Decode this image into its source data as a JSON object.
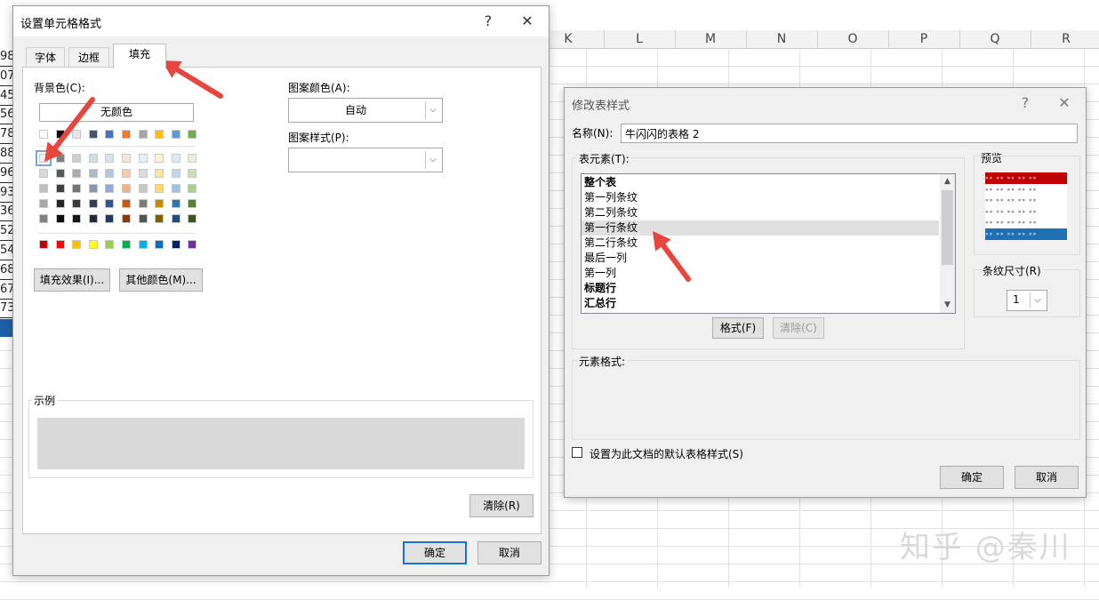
{
  "spreadsheet": {
    "columns": [
      "K",
      "L",
      "M",
      "N",
      "O",
      "P",
      "Q",
      "R"
    ],
    "row_cells": [
      "98",
      "07",
      "45",
      "56",
      "78",
      "88",
      "96",
      "93",
      "36",
      "52",
      "54",
      "68",
      "67",
      "73",
      ""
    ]
  },
  "format_cells": {
    "title": "设置单元格格式",
    "help": "?",
    "close": "✕",
    "tabs": [
      "字体",
      "边框",
      "填充"
    ],
    "active_tab": "填充",
    "background_color_label": "背景色(C):",
    "no_color": "无颜色",
    "pattern_color_label": "图案颜色(A):",
    "pattern_color_value": "自动",
    "pattern_style_label": "图案样式(P):",
    "pattern_style_value": "",
    "fill_effects_button": "填充效果(I)...",
    "more_colors_button": "其他颜色(M)...",
    "sample_label": "示例",
    "sample_color": "#d9d9d9",
    "clear_button": "清除(R)",
    "ok_button": "确定",
    "cancel_button": "取消",
    "theme_row": [
      "#ffffff",
      "#000000",
      "#e7e6e6",
      "#44546a",
      "#4472c4",
      "#ed7d31",
      "#a5a5a5",
      "#ffc000",
      "#5b9bd5",
      "#70ad47"
    ],
    "tint_rows": [
      [
        "#f2f2f2",
        "#7f7f7f",
        "#d0cece",
        "#d6dce4",
        "#d9e2f3",
        "#fbe5d5",
        "#ededed",
        "#fff2cc",
        "#ddebf7",
        "#e2efda"
      ],
      [
        "#d9d9d9",
        "#595959",
        "#aeaaaa",
        "#adb9ca",
        "#b4c6e7",
        "#f8cbad",
        "#dbdbdb",
        "#ffe599",
        "#bdd7ee",
        "#c6e0b4"
      ],
      [
        "#bfbfbf",
        "#404040",
        "#757171",
        "#8496b0",
        "#8eaadb",
        "#f4b183",
        "#c9c9c9",
        "#ffd966",
        "#9dc3e6",
        "#a9d08e"
      ],
      [
        "#a6a6a6",
        "#262626",
        "#3a3838",
        "#333f4f",
        "#2f5597",
        "#c55a11",
        "#7b7b7b",
        "#bf8f00",
        "#2e75b6",
        "#548235"
      ],
      [
        "#808080",
        "#0d0d0d",
        "#171616",
        "#222a35",
        "#1f3864",
        "#843c0b",
        "#525252",
        "#7f6000",
        "#1f4e79",
        "#375623"
      ]
    ],
    "standard_row": [
      "#c00000",
      "#ff0000",
      "#ffc000",
      "#ffff00",
      "#92d050",
      "#00b050",
      "#00b0f0",
      "#0070c0",
      "#002060",
      "#7030a0"
    ]
  },
  "modify_table_style": {
    "title": "修改表样式",
    "help": "?",
    "close": "✕",
    "name_label": "名称(N):",
    "name_value": "牛闪闪的表格 2",
    "table_element_label": "表元素(T):",
    "elements": [
      {
        "label": "整个表",
        "bold": true
      },
      {
        "label": "第一列条纹",
        "bold": false
      },
      {
        "label": "第二列条纹",
        "bold": false
      },
      {
        "label": "第一行条纹",
        "bold": false
      },
      {
        "label": "第二行条纹",
        "bold": false
      },
      {
        "label": "最后一列",
        "bold": false
      },
      {
        "label": "第一列",
        "bold": false
      },
      {
        "label": "标题行",
        "bold": true
      },
      {
        "label": "汇总行",
        "bold": true
      }
    ],
    "highlighted_element": "第一行条纹",
    "format_button": "格式(F)",
    "clear_button": "清除(C)",
    "preview_label": "预览",
    "preview_header_color": "#c00000",
    "preview_total_color": "#1f6fb5",
    "stripe_size_label": "条纹尺寸(R)",
    "stripe_size_value": "1",
    "element_format_label": "元素格式:",
    "default_checkbox_label": "设置为此文档的默认表格样式(S)",
    "ok_button": "确定",
    "cancel_button": "取消"
  },
  "watermark": "知乎 @秦川",
  "annotation_color": "#e8453c"
}
